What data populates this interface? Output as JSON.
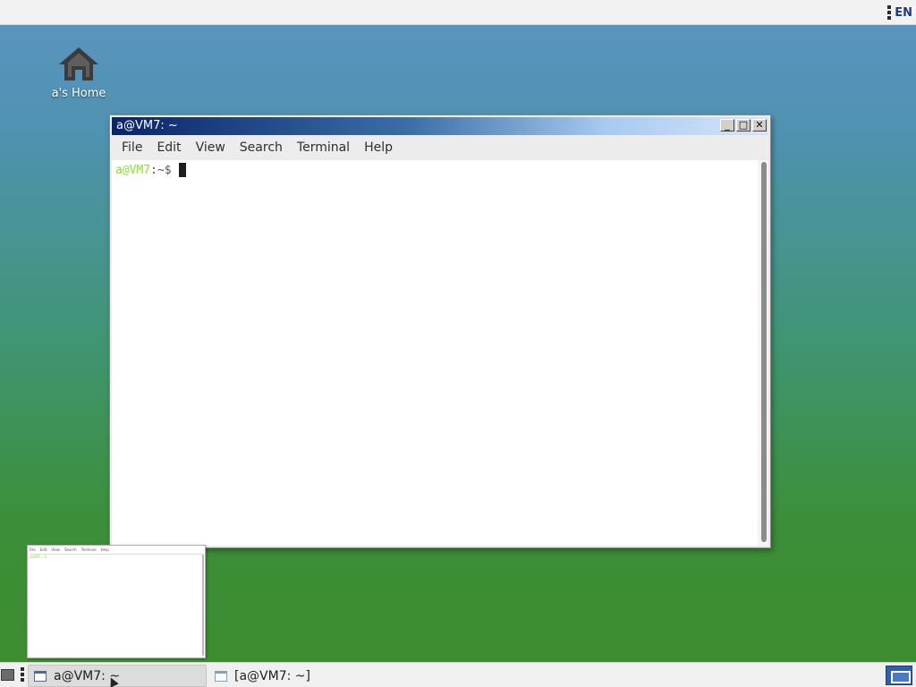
{
  "top_panel": {
    "language": "EN"
  },
  "desktop": {
    "home_icon_label": "a's Home"
  },
  "terminal_window": {
    "title": "a@VM7: ~",
    "buttons": {
      "minimize": "_",
      "maximize": "□",
      "close": "✕"
    },
    "menu": [
      "File",
      "Edit",
      "View",
      "Search",
      "Terminal",
      "Help"
    ],
    "prompt_user": "a@VM7",
    "prompt_rest": ":~$"
  },
  "preview": {
    "menu": [
      "File",
      "Edit",
      "View",
      "Search",
      "Terminal",
      "Help"
    ],
    "prompt": "a@VM7:~$"
  },
  "taskbar": {
    "tasks": [
      {
        "label": "a@VM7: ~",
        "active": true
      },
      {
        "label": "[a@VM7: ~]",
        "active": false
      }
    ]
  },
  "colors": {
    "prompt_user": "#8ae234",
    "titlebar_start": "#0a246a",
    "titlebar_end": "#d6e6f8"
  }
}
